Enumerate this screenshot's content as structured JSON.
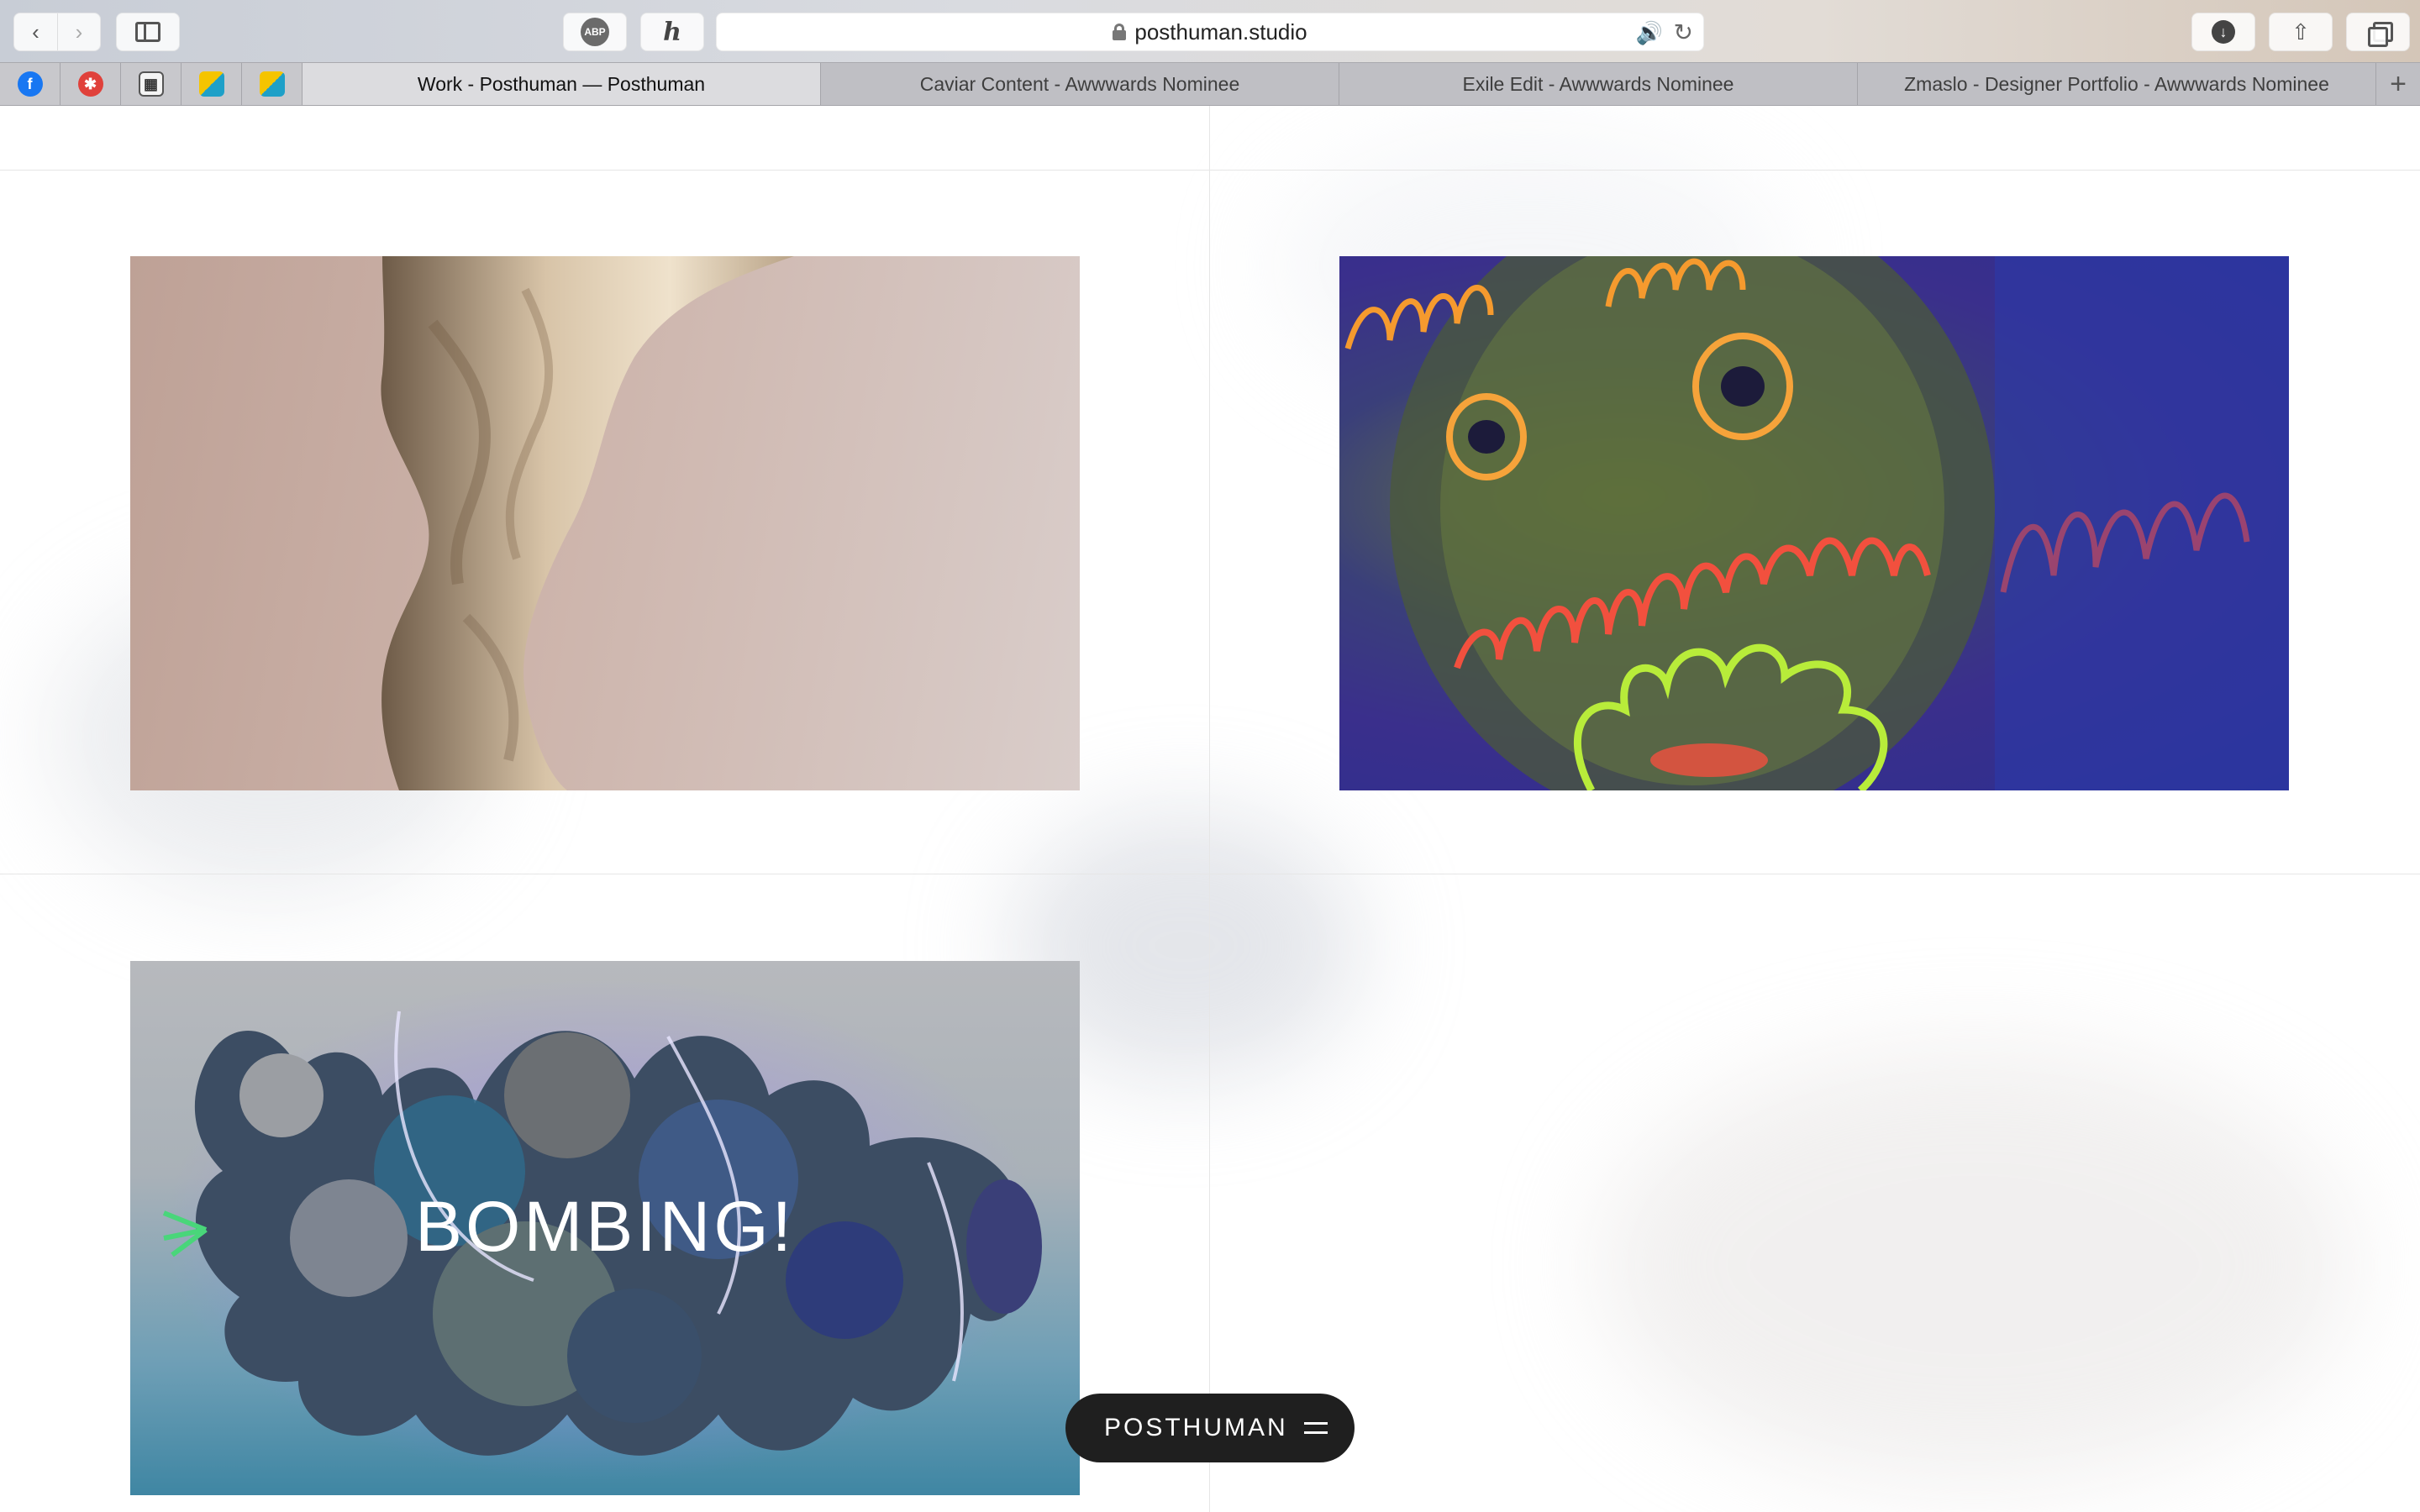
{
  "browser": {
    "url": "posthuman.studio",
    "abp_label": "ABP",
    "honey_glyph": "h",
    "back_glyph": "‹",
    "forward_glyph": "›",
    "speaker_glyph": "🔊",
    "reload_glyph": "↻",
    "download_glyph": "↓",
    "share_glyph": "⇧",
    "new_tab_glyph": "+",
    "pinned_tabs": [
      {
        "icon": "facebook-icon",
        "glyph": "f"
      },
      {
        "icon": "red-wheel-icon",
        "glyph": "✱"
      },
      {
        "icon": "grid-app-icon",
        "glyph": "▦"
      },
      {
        "icon": "yellow-blue-app-icon",
        "glyph": ""
      },
      {
        "icon": "yellow-blue-app-icon",
        "glyph": ""
      }
    ],
    "tabs": [
      {
        "title": "Work - Posthuman — Posthuman",
        "active": true
      },
      {
        "title": "Caviar Content - Awwwards Nominee",
        "active": false
      },
      {
        "title": "Exile Edit - Awwwards Nominee",
        "active": false
      },
      {
        "title": "Zmaslo - Designer Portfolio - Awwwards Nominee",
        "active": false
      }
    ]
  },
  "projects": [
    {
      "title": "",
      "image": "sculpted-skin-figure"
    },
    {
      "title": "",
      "image": "neon-painted-face"
    },
    {
      "title": "BOMBING!",
      "image": "coral-sculpture-cluster"
    }
  ],
  "nav": {
    "brand": "POSTHUMAN",
    "menu_icon": "hamburger-icon"
  },
  "colors": {
    "pill_bg": "#1f1f1f",
    "page_bg": "#ffffff",
    "grid_line": "#e6e6e6"
  }
}
